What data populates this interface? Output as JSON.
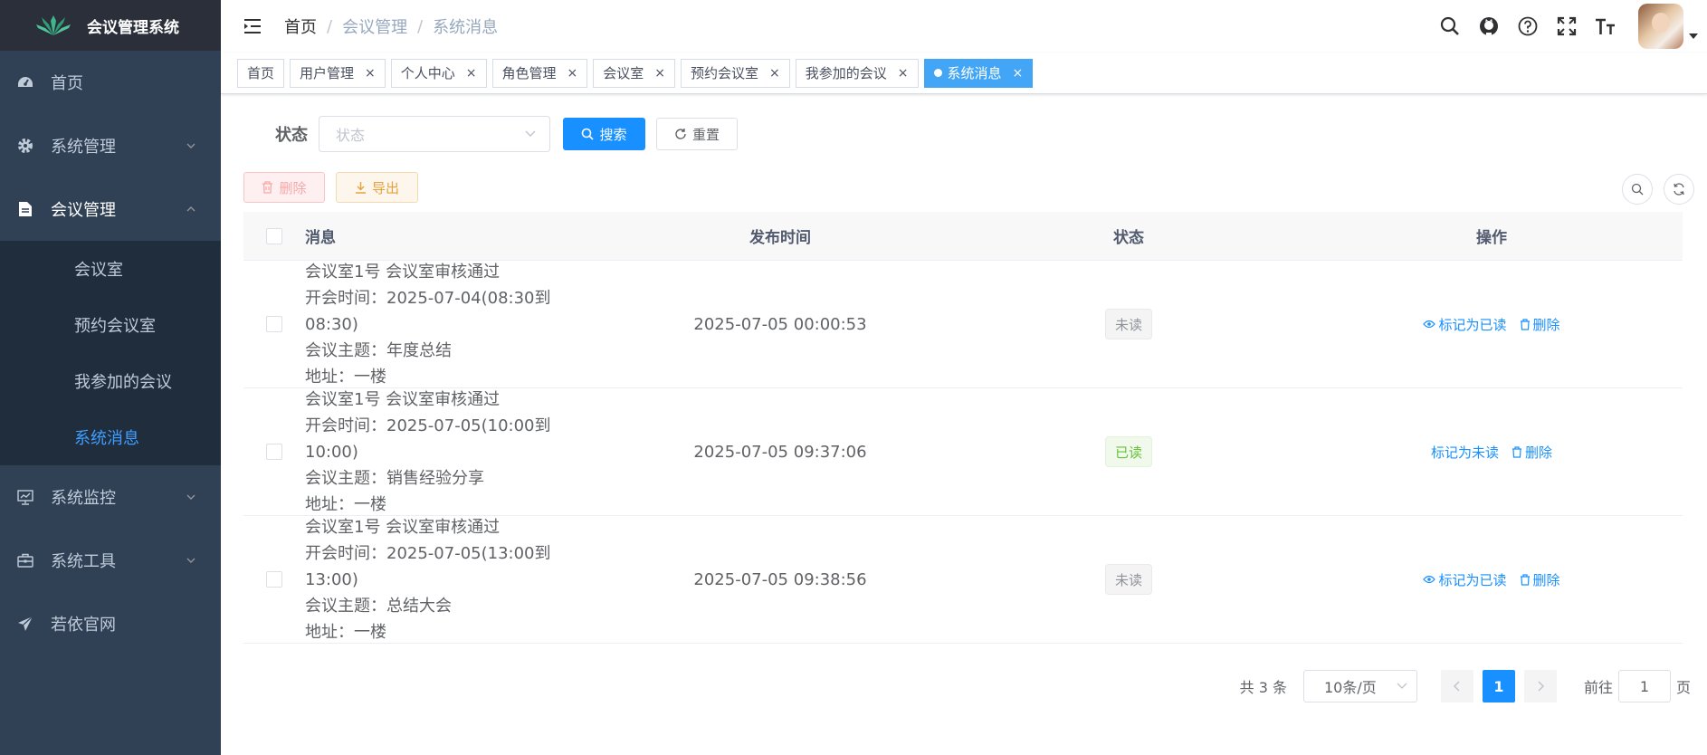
{
  "app": {
    "title": "会议管理系统"
  },
  "sidebar": {
    "items": [
      {
        "label": "首页",
        "icon": "dashboard-icon"
      },
      {
        "label": "系统管理",
        "icon": "gear-icon"
      },
      {
        "label": "会议管理",
        "icon": "document-icon",
        "expanded": true
      },
      {
        "label": "系统监控",
        "icon": "monitor-icon"
      },
      {
        "label": "系统工具",
        "icon": "toolbox-icon"
      },
      {
        "label": "若依官网",
        "icon": "paper-plane-icon"
      }
    ],
    "submenu": [
      {
        "label": "会议室"
      },
      {
        "label": "预约会议室"
      },
      {
        "label": "我参加的会议"
      },
      {
        "label": "系统消息",
        "active": true
      }
    ]
  },
  "breadcrumb": {
    "home": "首页",
    "sep": "/",
    "level1": "会议管理",
    "level2": "系统消息"
  },
  "tags": [
    {
      "label": "首页",
      "closable": false
    },
    {
      "label": "用户管理",
      "closable": true
    },
    {
      "label": "个人中心",
      "closable": true
    },
    {
      "label": "角色管理",
      "closable": true
    },
    {
      "label": "会议室",
      "closable": true
    },
    {
      "label": "预约会议室",
      "closable": true
    },
    {
      "label": "我参加的会议",
      "closable": true
    },
    {
      "label": "系统消息",
      "closable": true,
      "active": true
    }
  ],
  "search": {
    "status_label": "状态",
    "status_placeholder": "状态",
    "search_btn": "搜索",
    "reset_btn": "重置"
  },
  "toolbar": {
    "delete_btn": "删除",
    "export_btn": "导出"
  },
  "table": {
    "headers": {
      "message": "消息",
      "time": "发布时间",
      "status": "状态",
      "ops": "操作"
    },
    "rows": [
      {
        "lines": [
          "会议室1号 会议室审核通过",
          "开会时间：2025-07-04(08:30到 08:30)",
          "会议主题：年度总结",
          "地址：一楼"
        ],
        "time": "2025-07-05 00:00:53",
        "status": "未读",
        "action": "标记为已读",
        "delete": "删除"
      },
      {
        "lines": [
          "会议室1号 会议室审核通过",
          "开会时间：2025-07-05(10:00到 10:00)",
          "会议主题：销售经验分享",
          "地址：一楼"
        ],
        "time": "2025-07-05 09:37:06",
        "status": "已读",
        "action": "标记为未读",
        "delete": "删除"
      },
      {
        "lines": [
          "会议室1号 会议室审核通过",
          "开会时间：2025-07-05(13:00到 13:00)",
          "会议主题：总结大会",
          "地址：一楼"
        ],
        "time": "2025-07-05 09:38:56",
        "status": "未读",
        "action": "标记为已读",
        "delete": "删除"
      }
    ]
  },
  "pagination": {
    "total": "共 3 条",
    "page_size": "10条/页",
    "current": "1",
    "goto_label": "前往",
    "goto_value": "1",
    "page_suffix": "页"
  },
  "colors": {
    "sidebar": "#304156",
    "primary": "#1890ff",
    "active_menu": "#409eff"
  }
}
